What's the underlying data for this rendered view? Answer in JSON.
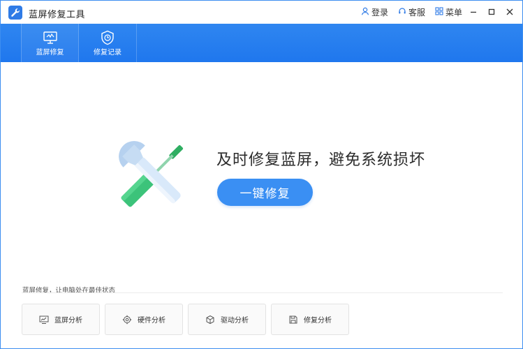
{
  "app": {
    "title": "蓝屏修复工具"
  },
  "header_actions": [
    {
      "label": "登录",
      "icon": "user-icon"
    },
    {
      "label": "客服",
      "icon": "headset-icon"
    },
    {
      "label": "菜单",
      "icon": "grid-menu-icon"
    }
  ],
  "window_controls": [
    "minimize",
    "maximize",
    "close"
  ],
  "nav": {
    "tabs": [
      {
        "label": "蓝屏修复",
        "icon": "monitor-icon",
        "active": true
      },
      {
        "label": "修复记录",
        "icon": "clock-shield-icon",
        "active": false
      }
    ]
  },
  "hero": {
    "headline": "及时修复蓝屏，避免系统损坏",
    "button_label": "一键修复"
  },
  "tools": {
    "caption": "蓝屏修复，让电脑处在最佳状态",
    "items": [
      {
        "label": "蓝屏分析",
        "icon": "chart-monitor-icon"
      },
      {
        "label": "硬件分析",
        "icon": "gear-icon"
      },
      {
        "label": "驱动分析",
        "icon": "cube-icon"
      },
      {
        "label": "修复分析",
        "icon": "floppy-icon"
      }
    ]
  },
  "colors": {
    "accent": "#2f86f0",
    "button": "#3a8ff3",
    "wrench": "#cfe3f7",
    "screwdriver": "#3cc37a"
  }
}
